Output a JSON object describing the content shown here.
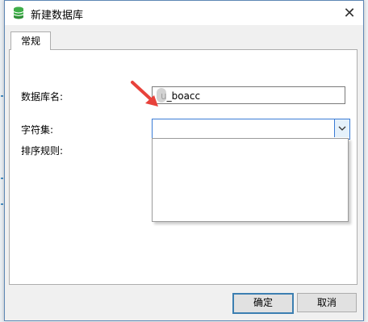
{
  "window": {
    "title": "新建数据库",
    "close_label": "✕"
  },
  "tabs": [
    {
      "label": "常规"
    }
  ],
  "form": {
    "db_name_label": "数据库名:",
    "db_name_value": "u_boacc",
    "charset_label": "字符集:",
    "charset_value": "",
    "collation_label": "排序规则:"
  },
  "buttons": {
    "ok_label": "确定",
    "cancel_label": "取消"
  },
  "colors": {
    "accent": "#3a7bd5",
    "arrow": "#e8423b",
    "db_icon": "#3fae49"
  }
}
